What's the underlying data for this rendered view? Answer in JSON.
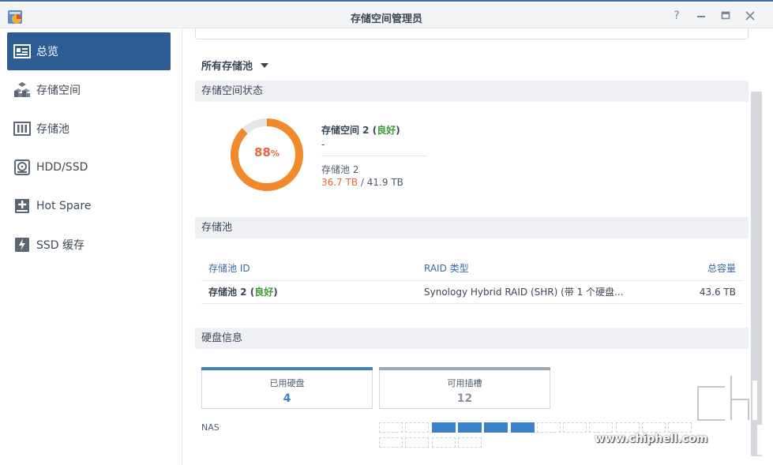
{
  "window": {
    "title": "存储空间管理员",
    "buttons": [
      "help-icon",
      "minimize-icon",
      "maximize-icon",
      "close-icon"
    ]
  },
  "sidebar": {
    "items": [
      {
        "label": "总览",
        "icon": "overview-icon",
        "active": true
      },
      {
        "label": "存储空间",
        "icon": "cubes-icon",
        "active": false
      },
      {
        "label": "存储池",
        "icon": "storage-pool-icon",
        "active": false
      },
      {
        "label": "HDD/SSD",
        "icon": "hdd-icon",
        "active": false
      },
      {
        "label": "Hot Spare",
        "icon": "hot-spare-icon",
        "active": false
      },
      {
        "label": "SSD 缓存",
        "icon": "ssd-cache-icon",
        "active": false
      }
    ]
  },
  "filter": {
    "label": "所有存储池"
  },
  "volume_status": {
    "heading": "存储空间状态",
    "percent_value": "88",
    "percent_sign": "%",
    "usage_fraction": 0.88,
    "volume_name": "存储空间 2",
    "status": "良好",
    "description": "-",
    "pool_name": "存储池 2",
    "used": "36.7 TB",
    "separator": " / ",
    "total": "41.9 TB"
  },
  "storage_pools": {
    "heading": "存储池",
    "columns": [
      "存储池 ID",
      "RAID 类型",
      "总容量"
    ],
    "rows": [
      {
        "name": "存储池 2",
        "status": "良好",
        "raid": "Synology Hybrid RAID (SHR) (带 1 个硬盘...",
        "capacity": "43.6 TB"
      }
    ]
  },
  "disk_info": {
    "heading": "硬盘信息",
    "used_label": "已用硬盘",
    "used_count": "4",
    "available_label": "可用插槽",
    "available_count": "12",
    "nas_label": "NAS",
    "slot_states": [
      0,
      0,
      1,
      1,
      1,
      1,
      0,
      0,
      0,
      0,
      0,
      0,
      0,
      0,
      0,
      0
    ]
  },
  "colors": {
    "accent": "#2e5d95",
    "used_orange": "#e8683a",
    "good_green": "#3a9a32",
    "slot_blue": "#3a82c8"
  },
  "watermark": {
    "url": "www.chiphell.com"
  }
}
